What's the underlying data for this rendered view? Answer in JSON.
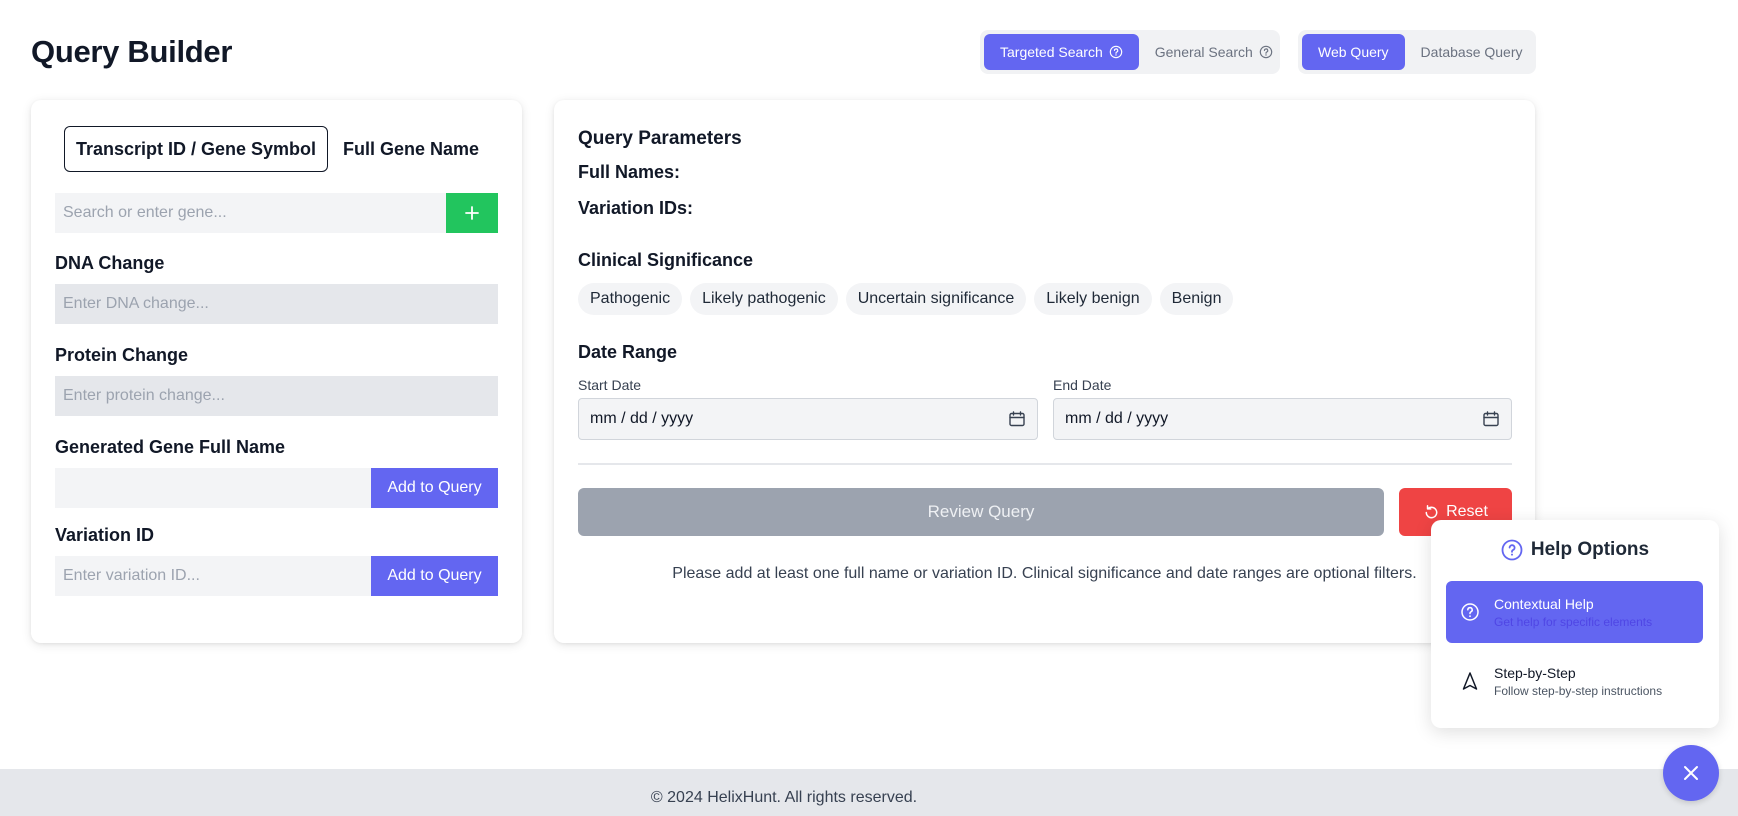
{
  "page": {
    "title": "Query Builder"
  },
  "search_mode": {
    "options": [
      {
        "label": "Targeted Search",
        "icon": "help-circle-icon",
        "active": true
      },
      {
        "label": "General Search",
        "icon": "help-circle-icon",
        "active": false
      }
    ]
  },
  "query_mode": {
    "options": [
      {
        "label": "Web Query",
        "active": true
      },
      {
        "label": "Database Query",
        "active": false
      }
    ]
  },
  "left": {
    "tabs": [
      {
        "label": "Transcript ID / Gene Symbol",
        "active": true
      },
      {
        "label": "Full Gene Name",
        "active": false
      }
    ],
    "gene_search": {
      "placeholder": "Search or enter gene...",
      "add_icon": "plus-icon"
    },
    "dna_change": {
      "label": "DNA Change",
      "placeholder": "Enter DNA change..."
    },
    "protein_change": {
      "label": "Protein Change",
      "placeholder": "Enter protein change..."
    },
    "generated_full_name": {
      "label": "Generated Gene Full Name",
      "value": "",
      "button": "Add to Query"
    },
    "variation_id": {
      "label": "Variation ID",
      "placeholder": "Enter variation ID...",
      "button": "Add to Query"
    }
  },
  "right": {
    "title": "Query Parameters",
    "full_names_label": "Full Names:",
    "variation_ids_label": "Variation IDs:",
    "clinical_significance": {
      "title": "Clinical Significance",
      "options": [
        "Pathogenic",
        "Likely pathogenic",
        "Uncertain significance",
        "Likely benign",
        "Benign"
      ]
    },
    "date_range": {
      "title": "Date Range",
      "start_label": "Start Date",
      "start_value": "mm / dd / yyyy",
      "end_label": "End Date",
      "end_value": "mm / dd / yyyy",
      "icon": "calendar-icon"
    },
    "review_button": "Review Query",
    "reset_button": "Reset",
    "help_text": "Please add at least one full name or variation ID. Clinical significance and date ranges are optional filters."
  },
  "help_panel": {
    "title": "Help Options",
    "items": [
      {
        "title": "Contextual Help",
        "description": "Get help for specific elements",
        "icon": "help-circle-icon",
        "active": true
      },
      {
        "title": "Step-by-Step",
        "description": "Follow step-by-step instructions",
        "icon": "navigation-icon",
        "active": false
      }
    ]
  },
  "fab": {
    "icon": "close-icon"
  },
  "footer": {
    "text": "© 2024 HelixHunt. All rights reserved."
  },
  "colors": {
    "accent": "#6366f1",
    "success": "#22c55e",
    "danger": "#ef4444",
    "disabled": "#9ca3af"
  }
}
